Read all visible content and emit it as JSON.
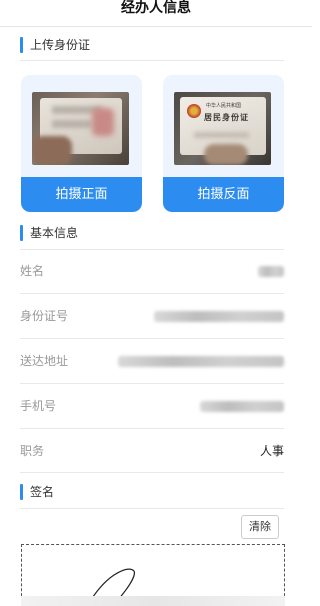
{
  "header": {
    "title": "经办人信息"
  },
  "upload_section": {
    "title": "上传身份证",
    "front_button": "拍摄正面",
    "back_button": "拍摄反面",
    "back_card_text_small": "中华人民共和国",
    "back_card_text_large": "居民身份证"
  },
  "basic_section": {
    "title": "基本信息",
    "fields": [
      {
        "label": "姓名",
        "value": ""
      },
      {
        "label": "身份证号",
        "value": ""
      },
      {
        "label": "送达地址",
        "value": ""
      },
      {
        "label": "手机号",
        "value": ""
      },
      {
        "label": "职务",
        "value": "人事"
      }
    ]
  },
  "signature_section": {
    "title": "签名",
    "clear_button": "清除"
  },
  "colors": {
    "accent": "#2d8cf0",
    "card_bg": "#eef4fd",
    "label_text": "#999999"
  }
}
